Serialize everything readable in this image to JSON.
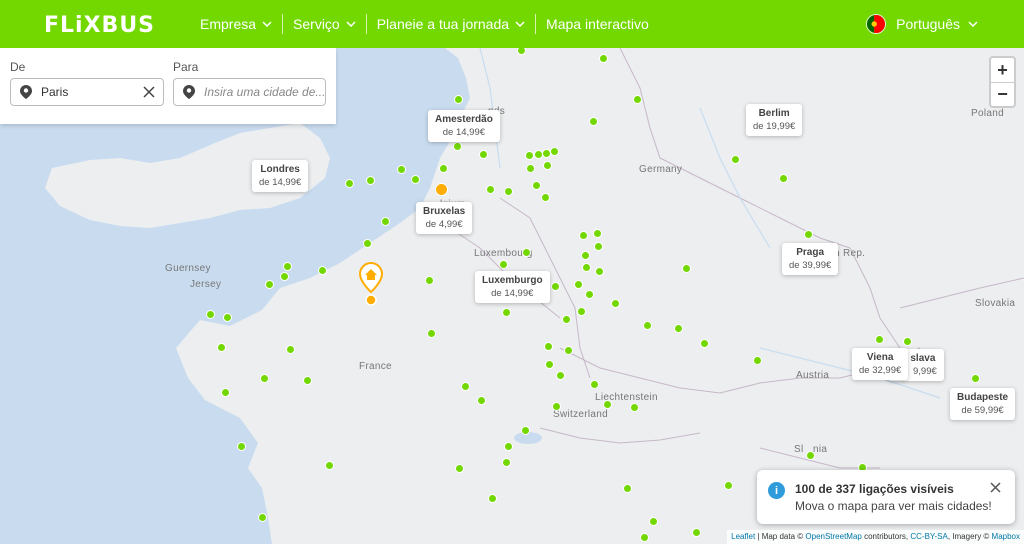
{
  "header": {
    "logo": "FLiXBUS",
    "nav": [
      "Empresa",
      "Serviço",
      "Planeie a tua jornada",
      "Mapa interactivo"
    ],
    "language": "Português"
  },
  "search": {
    "from_label": "De",
    "from_value": "Paris",
    "to_label": "Para",
    "to_placeholder": "Insira uma cidade de..."
  },
  "zoom": {
    "in": "+",
    "out": "−"
  },
  "cities": [
    {
      "name": "Amesterdão",
      "price": "de 14,99€"
    },
    {
      "name": "Berlim",
      "price": "de 19,99€"
    },
    {
      "name": "Londres",
      "price": "de 14,99€"
    },
    {
      "name": "Bruxelas",
      "price": "de 4,99€"
    },
    {
      "name": "Luxemburgo",
      "price": "de 14,99€"
    },
    {
      "name": "Praga",
      "price": "de 39,99€"
    },
    {
      "name": "Viena",
      "price": "de 32,99€"
    },
    {
      "name": "Budapeste",
      "price": "de 59,99€"
    }
  ],
  "partial_tooltip": {
    "name": "slava",
    "price": "9,99€"
  },
  "places": [
    "Poland",
    "Germany",
    "Luxembourg",
    "Guernsey",
    "Jersey",
    "France",
    "Austria",
    "Liechtenstein",
    "Switzerland",
    "Slovakia",
    "h Rep.",
    "Sl",
    "nia",
    "nds",
    "lgium"
  ],
  "info": {
    "title": "100 de 337 ligações visíveis",
    "subtitle": "Mova o mapa para ver mais cidades!"
  },
  "attribution": {
    "leaflet": "Leaflet",
    "text1": " | Map data © ",
    "osm": "OpenStreetMap",
    "text2": " contributors, ",
    "license": "CC-BY-SA",
    "text3": ", Imagery © ",
    "mapbox": "Mapbox"
  },
  "colors": {
    "brand": "#73d700",
    "selected": "#ffad00",
    "info": "#2f9bda",
    "sea": "#c9dcef",
    "land": "#eceef0"
  }
}
